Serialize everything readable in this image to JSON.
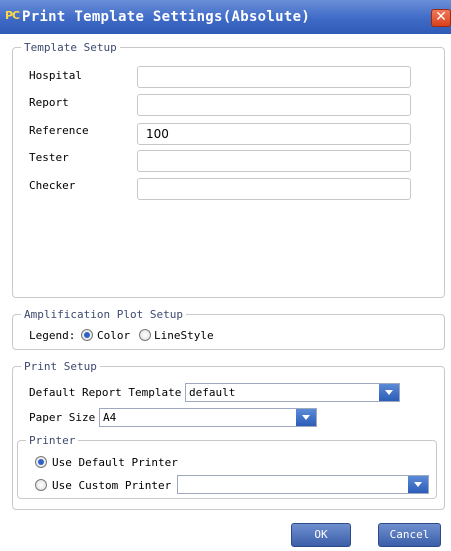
{
  "window": {
    "title": "Print Template Settings(Absolute)",
    "logo_text": "PC",
    "close_symbol": "✕"
  },
  "template_setup": {
    "legend": "Template Setup",
    "fields": [
      {
        "label": "Hospital",
        "value": ""
      },
      {
        "label": "Report",
        "value": ""
      },
      {
        "label": "Reference",
        "value": "100"
      },
      {
        "label": "Tester",
        "value": ""
      },
      {
        "label": "Checker",
        "value": ""
      }
    ]
  },
  "amplification": {
    "legend": "Amplification Plot Setup",
    "legend_label": "Legend:",
    "options": [
      {
        "label": "Color",
        "selected": true
      },
      {
        "label": "LineStyle",
        "selected": false
      }
    ]
  },
  "print_setup": {
    "legend": "Print Setup",
    "default_template_label": "Default Report Template",
    "default_template_value": "default",
    "paper_size_label": "Paper Size",
    "paper_size_value": "A4",
    "printer": {
      "legend": "Printer",
      "options": [
        {
          "label": "Use Default Printer",
          "selected": true
        },
        {
          "label": "Use Custom Printer",
          "selected": false
        }
      ],
      "custom_value": ""
    }
  },
  "buttons": {
    "ok": "OK",
    "cancel": "Cancel"
  },
  "colors": {
    "title_bar": "#3f6bc7",
    "close": "#d9401c",
    "accent": "#2c5db8"
  }
}
